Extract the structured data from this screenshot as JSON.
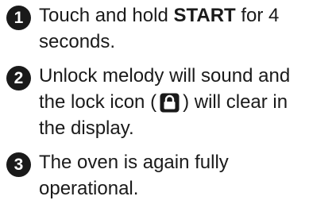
{
  "steps": [
    {
      "number": "1",
      "line1_pre": "Touch and hold ",
      "line1_bold": "START",
      "line1_post": " for 4",
      "line2": "seconds."
    },
    {
      "number": "2",
      "line1": "Unlock melody will sound and",
      "line2_pre": "the lock icon (",
      "line2_post": ") will clear in",
      "line2_icon": "lock-icon",
      "line3": "the display."
    },
    {
      "number": "3",
      "line1": "The oven is again fully",
      "line2": "operational."
    }
  ]
}
